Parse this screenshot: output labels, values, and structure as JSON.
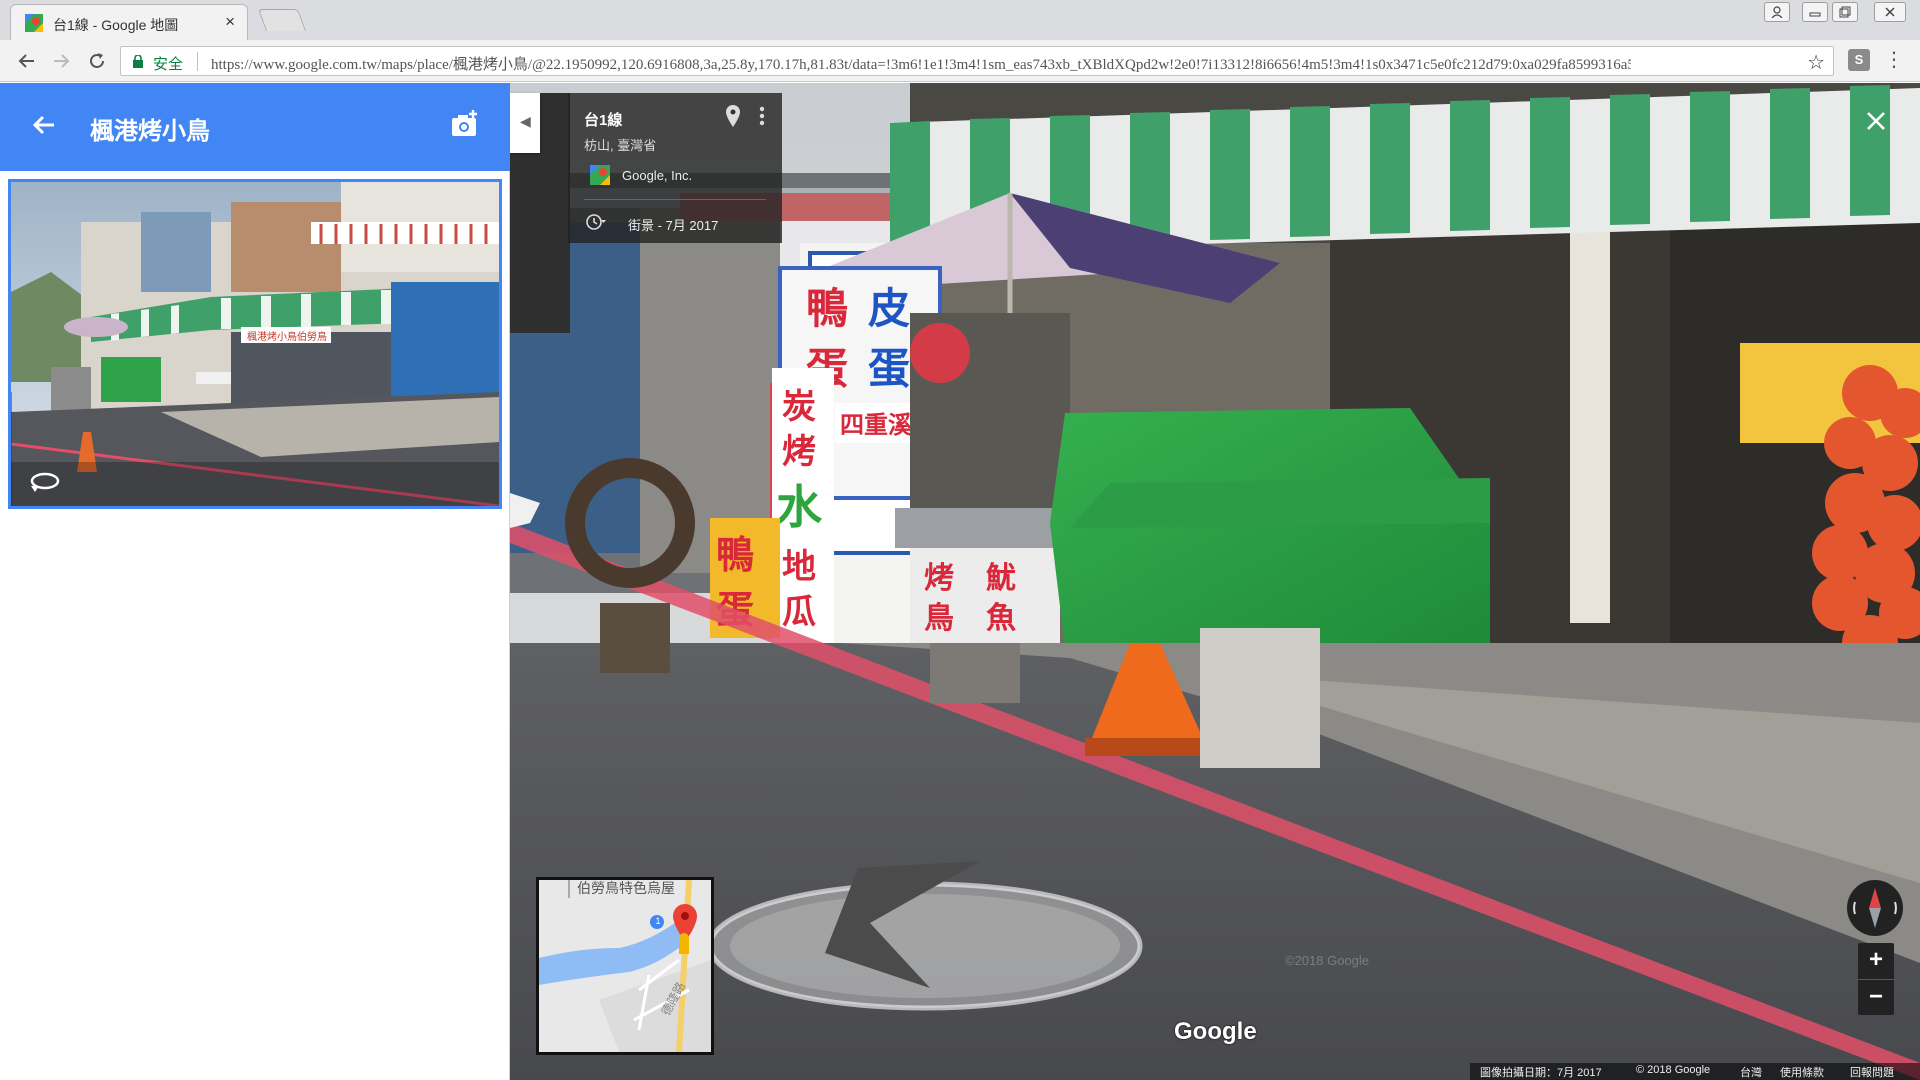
{
  "browser": {
    "tab_title": "台1線 - Google 地圖",
    "tab_close": "×",
    "secure_label": "安全",
    "url": "https://www.google.com.tw/maps/place/楓港烤小鳥/@22.1950992,120.6916808,3a,25.8y,170.17h,81.83t/data=!3m6!1e1!3m4!1sm_eas743xb_tXBldXQpd2w!2e0!7i13312!8i6656!4m5!3m4!1s0x3471c5e0fc212d79:0xa029fa8599316a5…",
    "ext_label": "S"
  },
  "panel": {
    "title": "楓港烤小鳥"
  },
  "streetview": {
    "road_name": "台1線",
    "region": "枋山, 臺灣省",
    "provider": "Google, Inc.",
    "capture_date": "街景 - 7月 2017",
    "logo": "Google",
    "watermark": "©2018 Google",
    "minimap_label": "伯勞鳥特色烏屋",
    "minimap_road": "德隆路",
    "minimap_route": "1",
    "zoom_in": "+",
    "zoom_out": "−",
    "footer": {
      "capture": "圖像拍攝日期：7月 2017",
      "copyright": "© 2018 Google",
      "region": "台灣",
      "terms": "使用條款",
      "report": "回報問題"
    }
  },
  "scene_text": {
    "sign_duck": "鴨蛋",
    "sign_pidan": "皮蛋",
    "sign_red": "炭烤",
    "sign_water": "水",
    "sign_potato": "地瓜",
    "sign_bird": "烤鳥",
    "sign_squid": "魷魚",
    "sign_banner": "四重溪紅",
    "sign_duck2": "鴨",
    "sign_egg2": "蛋",
    "thumb_banner": "楓港烤小鳥伯勞鳥"
  },
  "colors": {
    "maps_blue": "#4285f4",
    "awning_green": "#3fa06a",
    "tarp_green": "#2fa24a",
    "road_red": "#e0506a"
  }
}
